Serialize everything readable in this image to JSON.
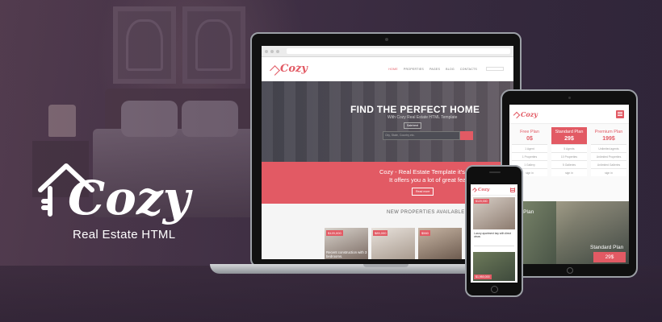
{
  "brand": {
    "name": "Cozy",
    "tagline": "Real Estate HTML",
    "accent_color": "#e25a64",
    "logo_icon": "house-key-icon"
  },
  "laptop_site": {
    "nav": [
      "HOME",
      "PROPERTIES",
      "PAGES",
      "BLOG",
      "CONTACTS"
    ],
    "nav_active": "HOME",
    "hero_title": "FIND THE PERFECT HOME",
    "hero_subtitle": "With Cozy Real Estate HTML Template",
    "hero_tab": "Sale/rent",
    "search_placeholder": "City, State, Country etc.",
    "promo_line1": "Cozy - Real Estate Template it's Awesome!",
    "promo_line2": "It offers you a lot of great features.",
    "promo_button": "Read more",
    "section_title": "NEW PROPERTIES AVAILABLE",
    "properties": [
      {
        "price": "$120,000",
        "caption": "Recent construction with 3 bedrooms."
      },
      {
        "price": "$85,000",
        "caption": ""
      },
      {
        "price": "$560",
        "caption": ""
      }
    ]
  },
  "tablet_site": {
    "plans": [
      {
        "name": "Free Plan",
        "price": "0$",
        "rows": [
          "1 Agent",
          "1 Properties",
          "1 Gallery",
          "sign in"
        ]
      },
      {
        "name": "Standard Plan",
        "price": "29$",
        "rows": [
          "5 Agents",
          "10 Properties",
          "5 Galleries",
          "sign in"
        ]
      },
      {
        "name": "Premium Plan",
        "price": "199$",
        "rows": [
          "Unlimited agents",
          "Unlimited Properties",
          "Unlimited Galleries",
          "sign in"
        ]
      }
    ],
    "photo_left": "Free Plan",
    "photo_plan": "Standard Plan",
    "photo_price": "29$"
  },
  "phone_site": {
    "card1_price": "$120,000",
    "card1_text": "Luxury apartment bay with direct views",
    "card2_price": "$1,950,000"
  }
}
